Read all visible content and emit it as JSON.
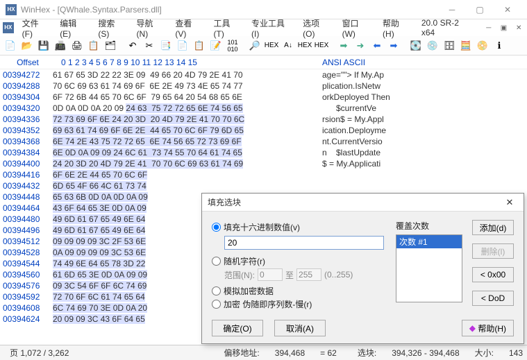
{
  "window": {
    "title": "WinHex - [QWhale.Syntax.Parsers.dll]",
    "version": "20.0 SR-2 x64"
  },
  "menus": [
    "文件(F)",
    "编辑(E)",
    "搜索(S)",
    "导航(N)",
    "查看(V)",
    "工具(T)",
    "专业工具(I)",
    "选项(O)",
    "窗口(W)",
    "帮助(H)"
  ],
  "hex": {
    "offset_label": "Offset",
    "cols": "0  1  2  3  4  5  6  7   8  9 10 11 12 13 14 15",
    "ascii_label": "ANSI ASCII",
    "rows": [
      {
        "o": "00394272",
        "h": "61 67 65 3D 22 22 3E 09  49 66 20 4D 79 2E 41 70",
        "a": "age=\"\"> If My.Ap"
      },
      {
        "o": "00394288",
        "h": "70 6C 69 63 61 74 69 6F  6E 2E 49 73 4E 65 74 77",
        "a": "plication.IsNetw"
      },
      {
        "o": "00394304",
        "h": "6F 72 6B 44 65 70 6C 6F  79 65 64 20 54 68 65 6E",
        "a": "orkDeployed Then"
      },
      {
        "o": "00394320",
        "h": "0D 0A 0D 0A 20 09 ",
        "hs": "24 63  75 72 72 65 6E 74 56 65",
        "a": "      $currentVe"
      },
      {
        "o": "00394336",
        "h": "",
        "hs": "72 73 69 6F 6E 24 20 3D  20 4D 79 2E 41 70 70 6C",
        "a": "rsion$ = My.Appl"
      },
      {
        "o": "00394352",
        "h": "",
        "hs": "69 63 61 74 69 6F 6E 2E  44 65 70 6C 6F 79 6D 65",
        "a": "ication.Deployme"
      },
      {
        "o": "00394368",
        "h": "",
        "hs": "6E 74 2E 43 75 72 72 65  6E 74 56 65 72 73 69 6F",
        "a": "nt.CurrentVersio"
      },
      {
        "o": "00394384",
        "h": "",
        "hs": "6E 0D 0A 09 09 24 6C 61  73 74 55 70 64 61 74 65",
        "a": "n    $lastUpdate"
      },
      {
        "o": "00394400",
        "h": "",
        "hs": "24 20 3D 20 4D 79 2E 41  70 70 6C 69 63 61 74 69",
        "a": "$ = My.Applicati"
      },
      {
        "o": "00394416",
        "h": "",
        "hs": "6F 6E 2E 44 65 70 6C 6F",
        "a": ""
      },
      {
        "o": "00394432",
        "h": "",
        "hs": "6D 65 4F 66 4C 61 73 74",
        "a": ""
      },
      {
        "o": "00394448",
        "h": "",
        "hs": "65 63 6B 0D 0A 0D 0A 09",
        "a": ""
      },
      {
        "o": "00394464",
        "h": "",
        "hs": "43 6F 64 65 3E 0D 0A 09",
        "a": ""
      },
      {
        "o": "00394480",
        "h": "",
        "hs": "49 6D 61 67 65 49 6E 64",
        "a": ""
      },
      {
        "o": "00394496",
        "h": "",
        "hs": "49 6D 61 67 65 49 6E 64",
        "a": ""
      },
      {
        "o": "00394512",
        "h": "",
        "hs": "09 09 09 09 3C 2F 53 6E",
        "a": ""
      },
      {
        "o": "00394528",
        "h": "",
        "hs": "0A 09 09 09 09 3C 53 6E",
        "a": ""
      },
      {
        "o": "00394544",
        "h": "",
        "hs": "74 49 6E 64 65 78 3D 22",
        "a": ""
      },
      {
        "o": "00394560",
        "h": "",
        "hs": "61 6D 65 3E 0D 0A 09 09",
        "a": ""
      },
      {
        "o": "00394576",
        "h": "",
        "hs": "09 3C 54 6F 6F 6C 74 69",
        "a": ""
      },
      {
        "o": "00394592",
        "h": "",
        "hs": "72 70 6F 6C 61 74 65 64",
        "a": ""
      },
      {
        "o": "00394608",
        "h": "",
        "hs": "6C 74 69 70 3E 0D 0A 20",
        "a": ""
      },
      {
        "o": "00394624",
        "h": "",
        "hs": "20 09 09 3C 43 6F 64 65",
        "a": ""
      }
    ]
  },
  "status": {
    "page": "页 1,072 / 3,262",
    "offset_lbl": "偏移地址:",
    "offset_val": "394,468",
    "eq": "= 62",
    "sel_lbl": "选块:",
    "sel_val": "394,326 - 394,468",
    "size_lbl": "大小:",
    "size_val": "143"
  },
  "dialog": {
    "title": "填充选块",
    "opt_hex": "填充十六进制数值(v)",
    "hex_value": "20",
    "opt_random": "随机字符(r)",
    "range_lbl": "范围(N):",
    "range_from": "0",
    "range_to_lbl": "至",
    "range_to": "255",
    "range_hint": "(0..255)",
    "opt_sim": "模拟加密数据",
    "opt_enc": "加密 伪随即序列数-慢(r)",
    "passes_lbl": "覆盖次数",
    "pass_item": "次数 #1",
    "btn_add": "添加(d)",
    "btn_del": "删除(l)",
    "btn_0x00": "< 0x00",
    "btn_dod": "< DoD",
    "btn_ok": "确定(O)",
    "btn_cancel": "取消(A)",
    "btn_help": "帮助(H)"
  }
}
